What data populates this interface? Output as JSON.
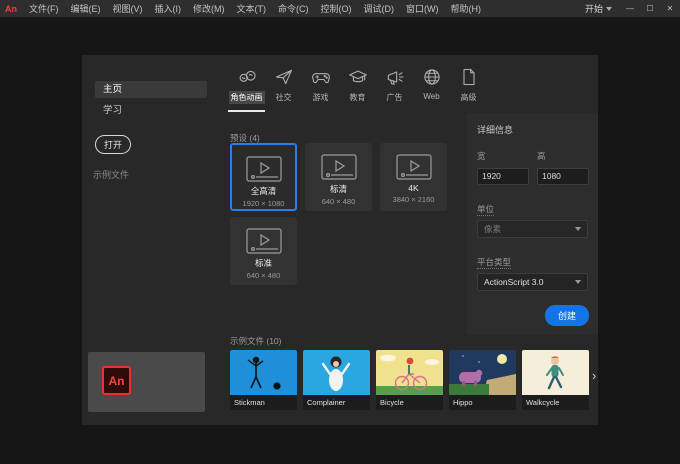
{
  "titlebar": {
    "logo": "An",
    "menus": [
      "文件(F)",
      "编辑(E)",
      "视图(V)",
      "插入(I)",
      "修改(M)",
      "文本(T)",
      "命令(C)",
      "控制(O)",
      "调试(D)",
      "窗口(W)",
      "帮助(H)"
    ],
    "start_label": "开始",
    "minimize": "—",
    "maximize": "☐",
    "close": "✕"
  },
  "sidebar": {
    "items": [
      {
        "label": "主页",
        "active": true
      },
      {
        "label": "学习",
        "active": false
      }
    ],
    "open_button": "打开",
    "recent_label": "示例文件"
  },
  "tabs": [
    {
      "label": "角色动画",
      "active": true
    },
    {
      "label": "社交",
      "active": false
    },
    {
      "label": "游戏",
      "active": false
    },
    {
      "label": "教育",
      "active": false
    },
    {
      "label": "广告",
      "active": false
    },
    {
      "label": "Web",
      "active": false
    },
    {
      "label": "高级",
      "active": false
    }
  ],
  "presets": {
    "header": "预设 (4)",
    "cards": [
      {
        "name": "全高清",
        "dims": "1920 × 1080",
        "selected": true
      },
      {
        "name": "标清",
        "dims": "640 × 480",
        "selected": false
      },
      {
        "name": "4K",
        "dims": "3840 × 2160",
        "selected": false
      },
      {
        "name": "标准",
        "dims": "640 × 480",
        "selected": false
      }
    ]
  },
  "details": {
    "header": "详细信息",
    "width_label": "宽",
    "width_value": "1920",
    "height_label": "高",
    "height_value": "1080",
    "units_label": "单位",
    "units_value": "像素",
    "platform_label": "平台类型",
    "platform_value": "ActionScript 3.0",
    "create_button": "创建"
  },
  "samples": {
    "header": "示例文件 (10)",
    "items": [
      {
        "name": "Stickman"
      },
      {
        "name": "Complainer"
      },
      {
        "name": "Bicycle"
      },
      {
        "name": "Hippo"
      },
      {
        "name": "Walkcycle"
      }
    ],
    "more": "›"
  },
  "colors": {
    "accent": "#1473e6",
    "logo_red": "#ff3b30",
    "selection_blue": "#2680eb"
  }
}
